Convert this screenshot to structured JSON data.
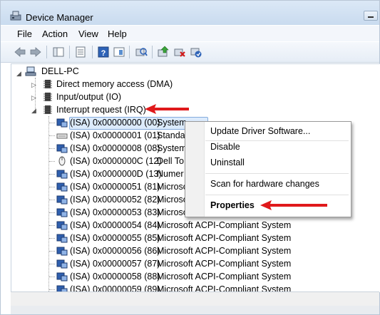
{
  "window": {
    "title": "Device Manager"
  },
  "menu": [
    "File",
    "Action",
    "View",
    "Help"
  ],
  "toolbar_icons": [
    "back-icon",
    "forward-icon",
    "up-icon",
    "show-hide-tree-icon",
    "properties-icon",
    "help-icon",
    "show-pane-icon",
    "scan-hardware-icon",
    "update-driver-icon",
    "uninstall-icon",
    "enable-icon"
  ],
  "tree": {
    "root": "DELL-PC",
    "categories": [
      {
        "label": "Direct memory access (DMA)",
        "state": "collapsed"
      },
      {
        "label": "Input/output (IO)",
        "state": "collapsed"
      },
      {
        "label": "Interrupt request (IRQ)",
        "state": "expanded"
      }
    ],
    "irq_items": [
      {
        "id": "(ISA) 0x00000000 (00)",
        "name": "System",
        "icon": "system-device-icon",
        "selected": true
      },
      {
        "id": "(ISA) 0x00000001 (01)",
        "name": "Standar",
        "icon": "keyboard-icon"
      },
      {
        "id": "(ISA) 0x00000008 (08)",
        "name": "System",
        "icon": "system-device-icon"
      },
      {
        "id": "(ISA) 0x0000000C (12)",
        "name": "Dell To",
        "icon": "mouse-icon"
      },
      {
        "id": "(ISA) 0x0000000D (13)",
        "name": "Numer",
        "icon": "system-device-icon"
      },
      {
        "id": "(ISA) 0x00000051 (81)",
        "name": "Microso",
        "icon": "system-device-icon"
      },
      {
        "id": "(ISA) 0x00000052 (82)",
        "name": "Microso",
        "icon": "system-device-icon"
      },
      {
        "id": "(ISA) 0x00000053 (83)",
        "name": "Microso",
        "icon": "system-device-icon"
      },
      {
        "id": "(ISA) 0x00000054 (84)",
        "name": "Microsoft ACPI-Compliant System",
        "icon": "system-device-icon"
      },
      {
        "id": "(ISA) 0x00000055 (85)",
        "name": "Microsoft ACPI-Compliant System",
        "icon": "system-device-icon"
      },
      {
        "id": "(ISA) 0x00000056 (86)",
        "name": "Microsoft ACPI-Compliant System",
        "icon": "system-device-icon"
      },
      {
        "id": "(ISA) 0x00000057 (87)",
        "name": "Microsoft ACPI-Compliant System",
        "icon": "system-device-icon"
      },
      {
        "id": "(ISA) 0x00000058 (88)",
        "name": "Microsoft ACPI-Compliant System",
        "icon": "system-device-icon"
      },
      {
        "id": "(ISA) 0x00000059 (89)",
        "name": "Microsoft ACPI-Compliant System",
        "icon": "system-device-icon"
      }
    ]
  },
  "context_menu": {
    "items": [
      "Update Driver Software...",
      "Disable",
      "Uninstall",
      "Scan for hardware changes",
      "Properties"
    ]
  },
  "colors": {
    "annotation_arrow": "#e0191b",
    "selection": "#dcebfc"
  }
}
